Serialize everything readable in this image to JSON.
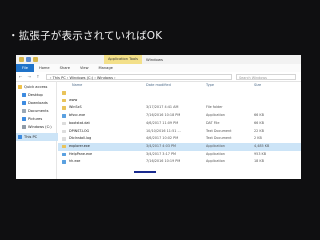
{
  "headline": "・拡張子が表示されていればOK",
  "window": {
    "title": "Windows",
    "context_tab": "Application Tools",
    "ribbon_tabs": [
      "File",
      "Home",
      "Share",
      "View",
      "Manage"
    ],
    "nav_buttons": "← → ↑",
    "breadcrumb": "› This PC › Windows (C:) › Windows ›",
    "search_placeholder": "Search Windows"
  },
  "nav_pane": [
    {
      "label": "Quick access",
      "color": "#f0c24a"
    },
    {
      "label": "Desktop",
      "color": "#3d8be0"
    },
    {
      "label": "Downloads",
      "color": "#3d8be0"
    },
    {
      "label": "Documents",
      "color": "#9aa8b6"
    },
    {
      "label": "Pictures",
      "color": "#3d8be0"
    },
    {
      "label": "Windows (C:)",
      "color": "#8f9aa6"
    },
    {
      "label": "This PC",
      "color": "#3d8be0"
    }
  ],
  "columns": {
    "name": "Name",
    "modified": "Date modified",
    "type": "Type",
    "size": "Size"
  },
  "files": [
    {
      "name": "",
      "modified": "",
      "type": "",
      "size": "",
      "color": "#e9c35a"
    },
    {
      "name": "www",
      "modified": "",
      "type": "",
      "size": "",
      "color": "#e9c35a"
    },
    {
      "name": "WinSxS",
      "modified": "3/17/2017 4:41 AM",
      "type": "File folder",
      "size": "",
      "color": "#e9c35a"
    },
    {
      "name": "bfsvc.exe",
      "modified": "7/16/2016 10:18 PM",
      "type": "Application",
      "size": "66 KB",
      "color": "#5aa0e0"
    },
    {
      "name": "bootstat.dat",
      "modified": "4/6/2017 11:09 PM",
      "type": "DAT File",
      "size": "66 KB",
      "color": "#dcdcdc"
    },
    {
      "name": "DPINST.LOG",
      "modified": "10/10/2016 11:51 ...",
      "type": "Text Document",
      "size": "22 KB",
      "color": "#dcdcdc"
    },
    {
      "name": "DtcInstall.log",
      "modified": "4/6/2017 10:02 PM",
      "type": "Text Document",
      "size": "2 KB",
      "color": "#dcdcdc"
    },
    {
      "name": "explorer.exe",
      "modified": "3/4/2017 4:03 PM",
      "type": "Application",
      "size": "4,485 KB",
      "color": "#e9c35a"
    },
    {
      "name": "HelpPane.exe",
      "modified": "3/4/2017 3:17 PM",
      "type": "Application",
      "size": "953 KB",
      "color": "#5aa0e0"
    },
    {
      "name": "hh.exe",
      "modified": "7/16/2016 10:19 PM",
      "type": "Application",
      "size": "18 KB",
      "color": "#5aa0e0"
    }
  ]
}
